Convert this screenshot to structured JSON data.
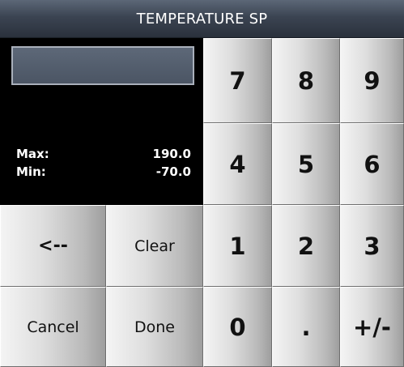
{
  "dialog": {
    "title": "TEMPERATURE SP",
    "entry_value": "",
    "limits": {
      "max_label": "Max:",
      "max_value": "190.0",
      "min_label": "Min:",
      "min_value": "-70.0"
    }
  },
  "keypad": {
    "k7": "7",
    "k8": "8",
    "k9": "9",
    "k4": "4",
    "k5": "5",
    "k6": "6",
    "k1": "1",
    "k2": "2",
    "k3": "3",
    "k0": "0",
    "dot": ".",
    "sign": "+/-"
  },
  "actions": {
    "backspace": "<--",
    "clear": "Clear",
    "cancel": "Cancel",
    "done": "Done"
  },
  "colors": {
    "title_bar": "#3b4452",
    "panel_background": "#000000",
    "button_light": "#f4f4f4",
    "button_dark": "#9e9e9e"
  }
}
